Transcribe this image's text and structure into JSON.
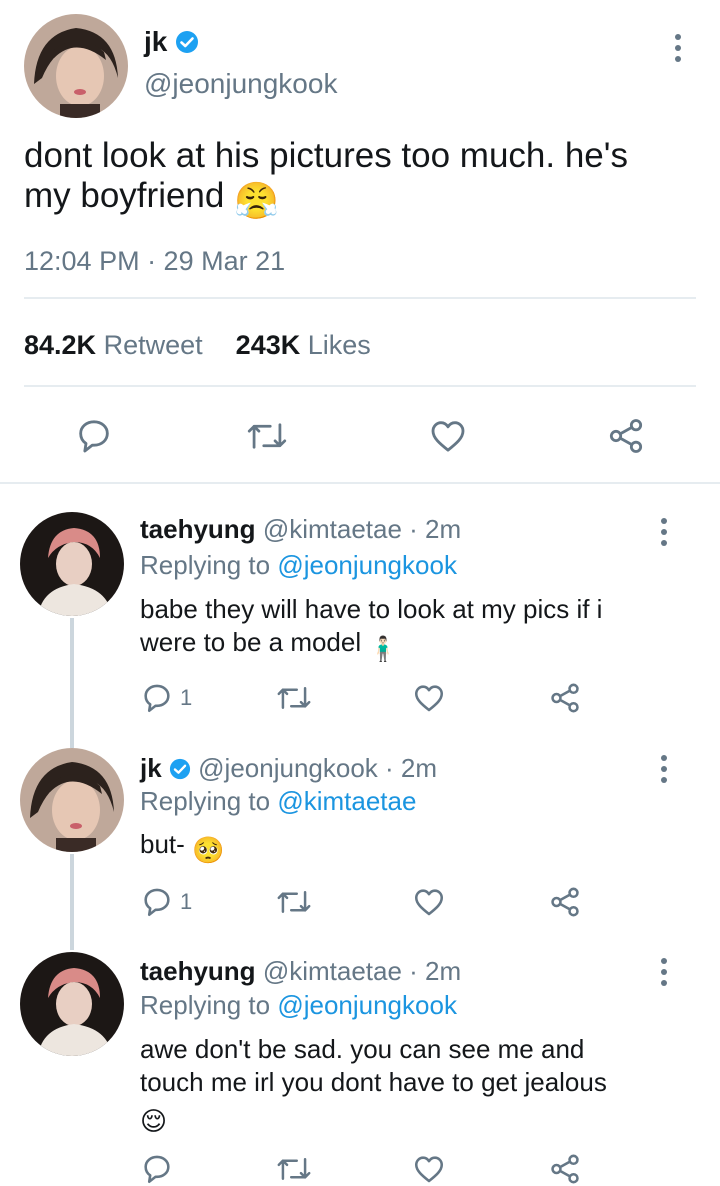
{
  "main_tweet": {
    "display_name": "jk",
    "handle": "@jeonjungkook",
    "text_line1": "dont look at his pictures too much. he's",
    "text_line2": "my boyfriend",
    "emoji": "😤",
    "timestamp": "12:04 PM · 29 Mar 21",
    "retweet_count": "84.2K",
    "retweet_label": "Retweet",
    "likes_count": "243K",
    "likes_label": "Likes"
  },
  "replies": [
    {
      "display_name": "taehyung",
      "meta": "@kimtaetae · 2m",
      "replying_prefix": "Replying to",
      "replying_to": "@jeonjungkook",
      "text_line1": "babe they will have to look at my pics if i",
      "text_line2": "were to be a model",
      "emoji": "🧍🏻‍♂️",
      "reply_count": "1"
    },
    {
      "display_name": "jk",
      "meta": "@jeonjungkook · 2m",
      "replying_prefix": "Replying to",
      "replying_to": "@kimtaetae",
      "text_line1": "but-",
      "emoji": "🥺",
      "reply_count": "1"
    },
    {
      "display_name": "taehyung",
      "meta": "@kimtaetae · 2m",
      "replying_prefix": "Replying to",
      "replying_to": "@jeonjungkook",
      "text_line1": "awe don't be sad. you can see me and",
      "text_line2": "touch me irl you dont have to get jealous",
      "emoji": "😌"
    }
  ],
  "colors": {
    "link": "#1b95e0",
    "verified": "#1da1f2",
    "muted": "#657786",
    "divider": "#e6ecf0",
    "thread_line": "#ccd6dd"
  },
  "icons": [
    "reply-icon",
    "retweet-icon",
    "like-icon",
    "share-icon",
    "more-options-icon",
    "verified-badge-icon"
  ]
}
